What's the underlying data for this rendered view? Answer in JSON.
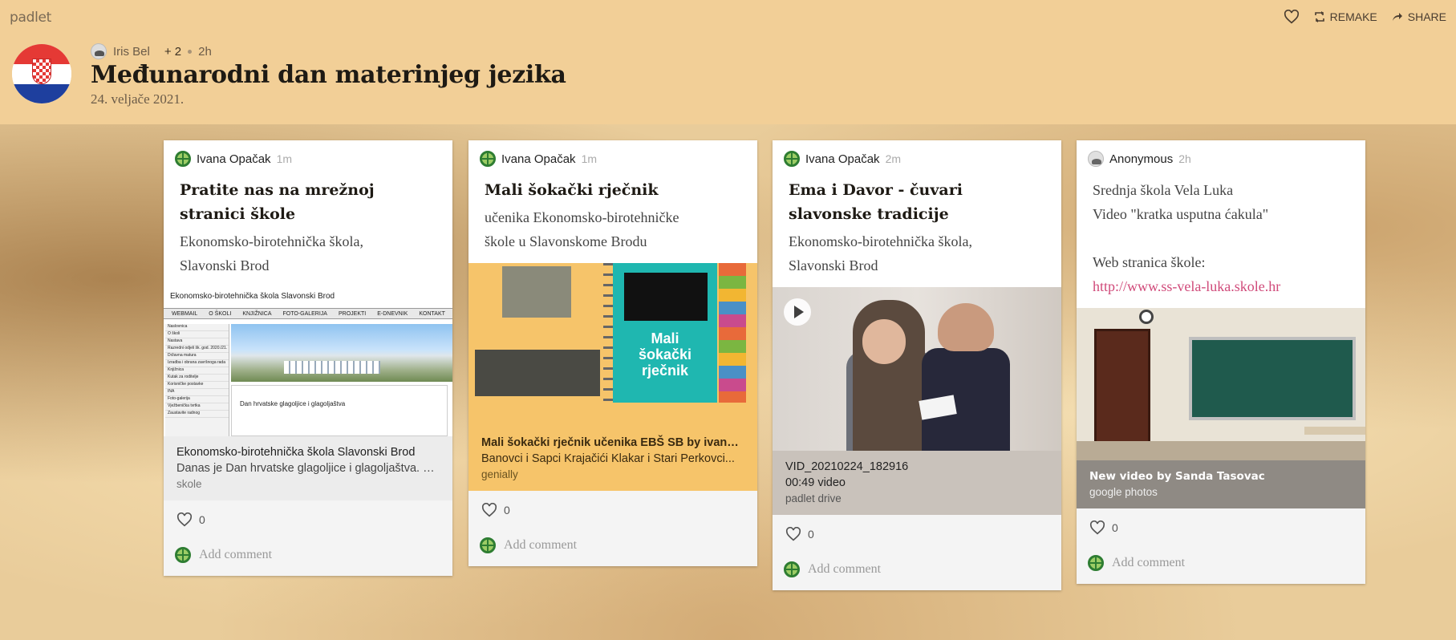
{
  "app": {
    "brand": "padlet"
  },
  "top_actions": {
    "remake_label": "REMAKE",
    "share_label": "SHARE"
  },
  "header": {
    "author": "Iris Bel",
    "collaborators": "+ 2",
    "time": "2h",
    "title": "Međunarodni dan materinjeg jezika",
    "subtitle": "24. veljače 2021."
  },
  "comment_placeholder": "Add comment",
  "cards": [
    {
      "author": "Ivana Opačak",
      "time": "1m",
      "title": "Pratite nas na mrežnoj stranici škole",
      "body": [
        "Ekonomsko-birotehnička škola,",
        "Slavonski Brod"
      ],
      "image_text": {
        "header": "Ekonomsko-birotehnička škola Slavonski Brod",
        "menu": [
          "WEBMAIL",
          "O ŠKOLI",
          "KNJIŽNICA",
          "FOTO-GALERIJA",
          "PROJEKTI",
          "E-DNEVNIK",
          "KONTAKT"
        ],
        "side": [
          "Naslovnica",
          "O školi",
          "Nastava",
          "Razredni odjeli šk. god. 2020./21.",
          "Državna matura",
          "Izradba i obrana završnoga rada",
          "Knjižnica",
          "Kutak za roditelje",
          "Korisničke postavke",
          "INA",
          "Foto-galerija",
          "Vježbenička tvrtka",
          "Zaustavite radnog"
        ],
        "news": "Dan hrvatske glagoljice i glagoljaštva"
      },
      "attachment": {
        "title": "Ekonomsko-birotehnička škola Slavonski Brod",
        "desc": "Danas je Dan hrvatske glagoljice i glagoljaštva. U hrvatskoj književnosti...",
        "source": "skole"
      },
      "likes": "0"
    },
    {
      "author": "Ivana Opačak",
      "time": "1m",
      "title": "Mali šokački rječnik",
      "body": [
        "učenika Ekonomsko-birotehničke",
        "škole u Slavonskome Brodu"
      ],
      "image_text": {
        "cover": "Mali šokački rječnik"
      },
      "attachment": {
        "title": "Mali šokački rječnik učenika EBŠ SB by ivana.opacak",
        "desc": "Banovci i Sapci Krajačići Klakar i Stari Perkovci...",
        "source": "genially"
      },
      "likes": "0"
    },
    {
      "author": "Ivana Opačak",
      "time": "2m",
      "title": "Ema i Davor - čuvari slavonske tradicije",
      "body": [
        "Ekonomsko-birotehnička škola,",
        "Slavonski Brod"
      ],
      "attachment": {
        "title": "VID_20210224_182916",
        "desc": "00:49 video",
        "source": "padlet drive"
      },
      "likes": "0"
    },
    {
      "author": "Anonymous",
      "time": "2h",
      "body": [
        "Srednja škola Vela Luka",
        "Video \"kratka usputna ćakula\"",
        "",
        "Web stranica škole:"
      ],
      "link": "http://www.ss-vela-luka.skole.hr",
      "attachment": {
        "title": "New video by Sanda Tasovac",
        "source": "google photos"
      },
      "likes": "0"
    }
  ],
  "colors": {
    "header_bg": "#f2cf97",
    "link": "#d04a7a",
    "card2_caption_bg": "#f6c46a",
    "card3_caption_bg": "#c9c2bb",
    "card4_caption_bg": "#8f8a84"
  }
}
